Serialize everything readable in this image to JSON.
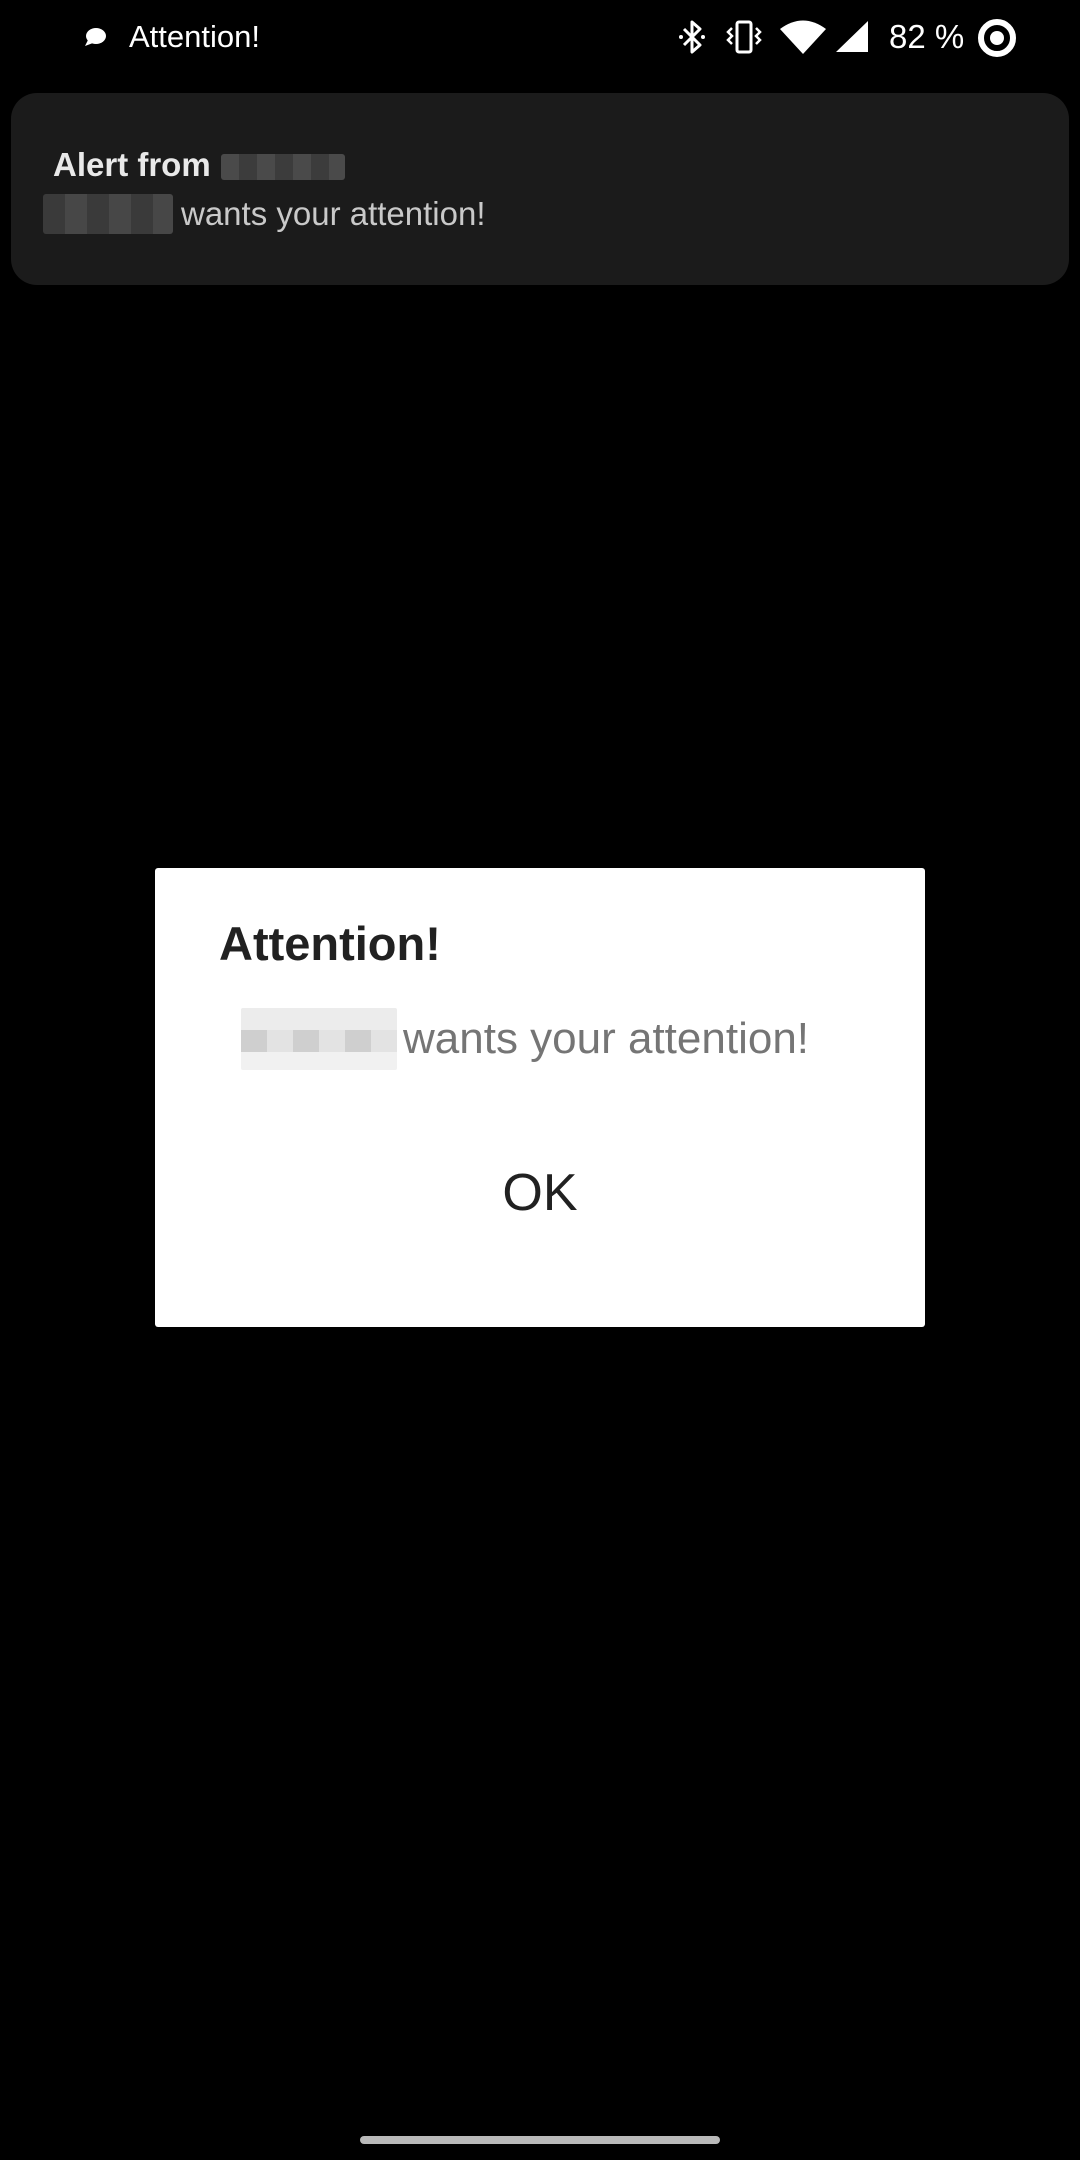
{
  "status_bar": {
    "title": "Attention!",
    "battery_text": "82 %",
    "icons": [
      "chat-bubble-icon",
      "bluetooth-icon",
      "vibrate-icon",
      "wifi-icon",
      "cellular-signal-icon",
      "battery-ring-icon"
    ],
    "battery_level": 0.82
  },
  "notification": {
    "title": "Alert from",
    "body": "wants your attention!"
  },
  "dialog": {
    "title": "Attention!",
    "message": "wants your attention!",
    "ok_label": "OK"
  },
  "colors": {
    "background": "#000000",
    "notification_bg": "#1b1b1b",
    "dialog_bg": "#ffffff",
    "dialog_title": "#212121",
    "dialog_message": "#757575"
  }
}
